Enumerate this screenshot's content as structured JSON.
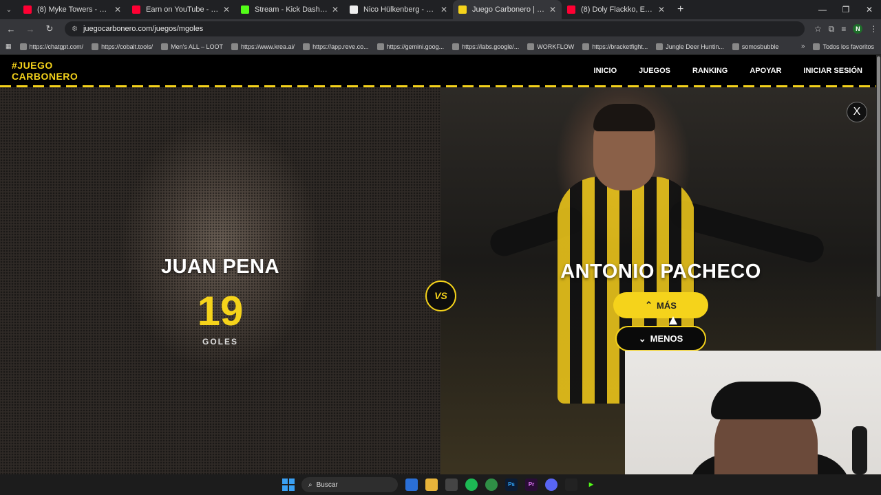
{
  "browser": {
    "tabs": [
      {
        "title": "(8) Myke Towers - Primer Meldó",
        "color": "#ff0033"
      },
      {
        "title": "Earn on YouTube - YouTube Stu",
        "color": "#ff0033"
      },
      {
        "title": "Stream - Kick Dashboard",
        "color": "#53fc18"
      },
      {
        "title": "Nico Hülkenberg - Wikipedia, la",
        "color": "#eeeeee"
      },
      {
        "title": "Juego Carbonero | Peñarol",
        "color": "#f5d31b"
      },
      {
        "title": "(8) Doly Flackko, Emirsito, G",
        "color": "#ff0033"
      }
    ],
    "url": "juegocarbonero.com/juegos/mgoles",
    "bookmarks": [
      "https://chatgpt.com/",
      "https://cobalt.tools/",
      "Men's ALL – LOOT",
      "https://www.krea.ai/",
      "https://app.reve.co...",
      "https://gemini.goog...",
      "https://labs.google/...",
      "WORKFLOW",
      "https://bracketfight...",
      "Jungle Deer Huntin...",
      "somosbubble"
    ],
    "all_bookmarks": "Todos los favoritos",
    "profile_initial": "N"
  },
  "site": {
    "logo_line1": "#JUEGO",
    "logo_line2": "CARBONERO",
    "nav": [
      "INICIO",
      "JUEGOS",
      "RANKING",
      "APOYAR",
      "INICIAR SESIÓN"
    ],
    "accent_color": "#f5d31b"
  },
  "game": {
    "left_player": {
      "name": "JUAN PENA",
      "goals": "19",
      "goals_label": "GOLES"
    },
    "vs_label": "VS",
    "right_player": {
      "name": "ANTONIO PACHECO"
    },
    "more_button": "MÁS",
    "less_button": "MENOS",
    "close_label": "X"
  },
  "taskbar": {
    "search_placeholder": "Buscar"
  }
}
